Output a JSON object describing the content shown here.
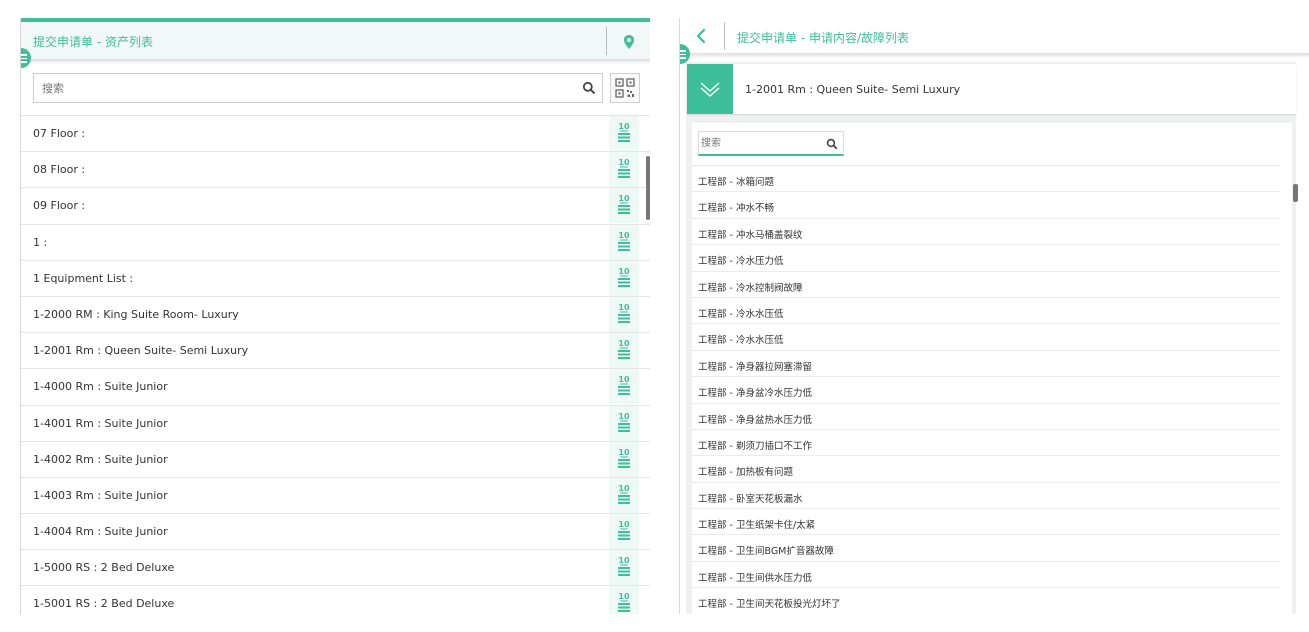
{
  "colors": {
    "accent": "#3dbf99",
    "header_bg": "#f2f8f7",
    "text": "#333333"
  },
  "left": {
    "title": "提交申请单 - 资产列表",
    "header_icon": "location-pin-icon",
    "search": {
      "placeholder": "搜索",
      "value": ""
    },
    "search_icon": "search-icon",
    "qr_icon": "qr-code-icon",
    "row_icon": "list-10-icon",
    "row_icon_number": "10",
    "rows": [
      "07 Floor :",
      "08 Floor :",
      "09 Floor :",
      "1 :",
      "1 Equipment List :",
      "1-2000 RM : King Suite Room- Luxury",
      "1-2001 Rm : Queen Suite- Semi Luxury",
      "1-4000 Rm : Suite Junior",
      "1-4001 Rm : Suite Junior",
      "1-4002 Rm : Suite Junior",
      "1-4003 Rm : Suite Junior",
      "1-4004 Rm : Suite Junior",
      "1-5000 RS : 2 Bed Deluxe",
      "1-5001 RS : 2 Bed Deluxe"
    ]
  },
  "right": {
    "title": "提交申请单 - 申请内容/故障列表",
    "back_icon": "chevron-left-icon",
    "asset_name": "1-2001 Rm : Queen Suite- Semi Luxury",
    "expand_icon": "double-chevron-down-icon",
    "search": {
      "placeholder": "搜索",
      "value": ""
    },
    "search_icon": "search-icon",
    "faults": [
      "工程部 - 冰箱问题",
      "工程部 - 冲水不畅",
      "工程部 - 冲水马桶盖裂纹",
      "工程部 - 冷水压力低",
      "工程部 - 冷水控制阀故障",
      "工程部 - 冷水水压低",
      "工程部 - 冷水水压低",
      "工程部 - 净身器拉网塞滞留",
      "工程部 - 净身盆冷水压力低",
      "工程部 - 净身盆热水压力低",
      "工程部 - 剃须刀插口不工作",
      "工程部 - 加热板有问题",
      "工程部 - 卧室天花板漏水",
      "工程部 - 卫生纸架卡住/太紧",
      "工程部 - 卫生间BGM扩音器故障",
      "工程部 - 卫生间供水压力低",
      "工程部 - 卫生间天花板投光灯坏了"
    ]
  }
}
